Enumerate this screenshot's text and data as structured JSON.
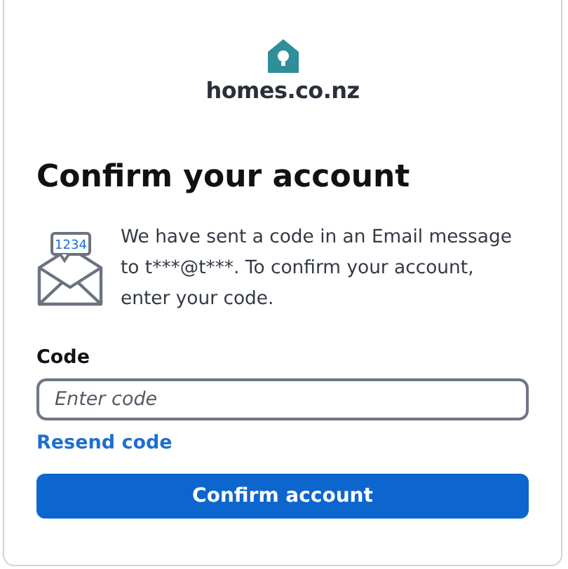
{
  "logo": {
    "text": "homes.co.nz"
  },
  "title": "Confirm your account",
  "message": {
    "icon_badge": "1234",
    "text": "We have sent a code in an Email message to t***@t***. To confirm your account, enter your code."
  },
  "code_field": {
    "label": "Code",
    "placeholder": "Enter code"
  },
  "resend_link": "Resend code",
  "submit_button": "Confirm account"
}
